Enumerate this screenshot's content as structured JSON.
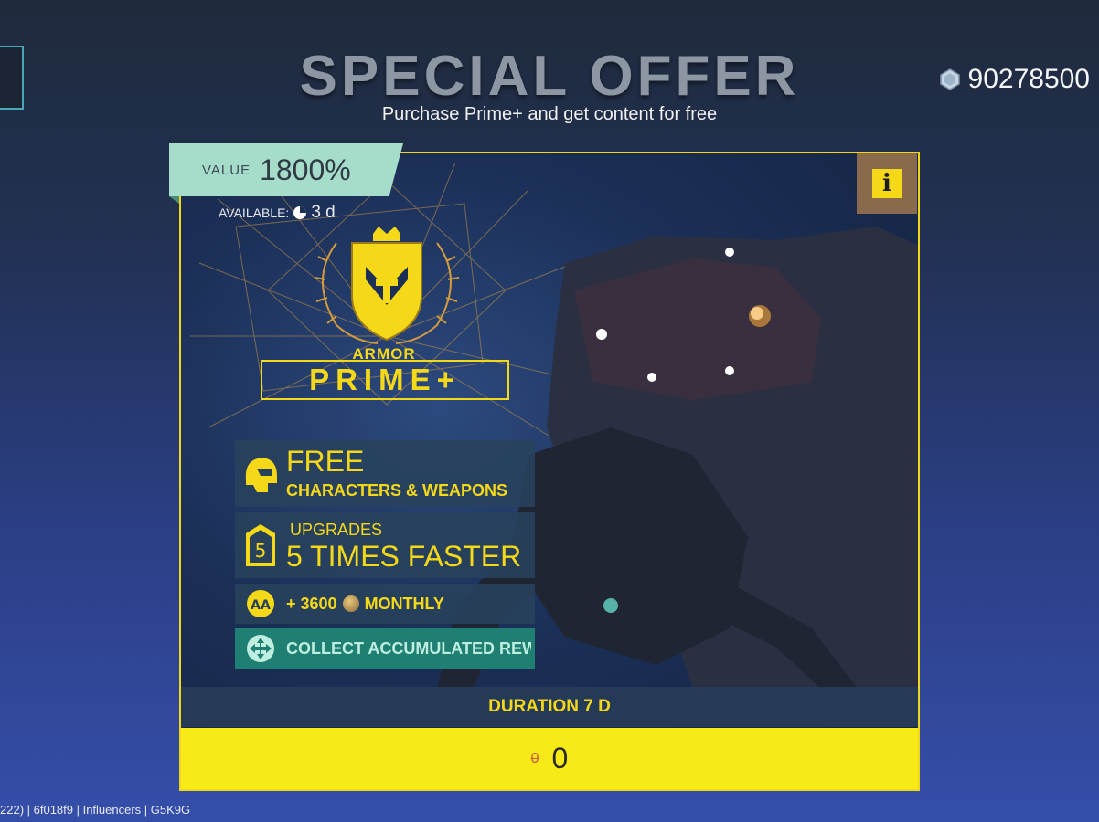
{
  "header": {
    "title": "SPECIAL OFFER",
    "subtitle": "Purchase Prime+ and get content for free",
    "currency_amount": "90278500",
    "currency_icon": "gem-icon"
  },
  "offer": {
    "value_label": "VALUE",
    "value_percent": "1800%",
    "available_label": "AVAILABLE:",
    "available_time": "3 d",
    "info_label": "i",
    "brand_small": "ARMOR",
    "brand_large": "PRIME+",
    "features": [
      {
        "icon": "helmet-icon",
        "line1": "FREE",
        "line2": "CHARACTERS & WEAPONS"
      },
      {
        "icon": "rank-5-icon",
        "line1": "UPGRADES",
        "line2": "5 TIMES FASTER"
      },
      {
        "icon": "aa-coin-icon",
        "amount": "+ 3600",
        "suffix": "MONTHLY"
      },
      {
        "icon": "collect-icon",
        "text": "COLLECT ACCUMULATED REWA"
      }
    ],
    "duration": "DURATION 7 D",
    "old_price": "0",
    "price": "0"
  },
  "debug_text": "222) | 6f018f9 | Influencers | G5K9G",
  "colors": {
    "accent_yellow": "#f5d818",
    "value_tag": "#a6dcca",
    "collect_bg": "#1f7f72"
  }
}
